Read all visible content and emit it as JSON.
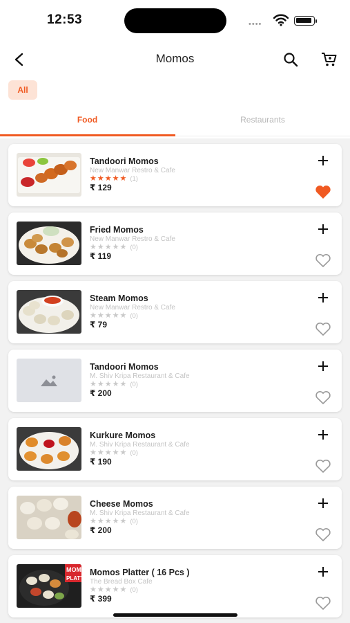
{
  "status_bar": {
    "time": "12:53"
  },
  "header": {
    "title": "Momos"
  },
  "filter": {
    "chip_label": "All"
  },
  "tabs": [
    {
      "label": "Food",
      "active": true
    },
    {
      "label": "Restaurants",
      "active": false
    }
  ],
  "colors": {
    "accent": "#f05a22",
    "chip_bg": "#fde3d6",
    "placeholder_bg": "#dfe1e6"
  },
  "items": [
    {
      "name": "Tandoori Momos",
      "restaurant": "New Manwar Restro & Cafe",
      "stars": "★★★★★",
      "rating_count": "(1)",
      "rating": 5,
      "price": "₹ 129",
      "favorite": true,
      "image": "tandoori-momos-photo"
    },
    {
      "name": "Fried Momos",
      "restaurant": "New Manwar Restro & Cafe",
      "stars": "★★★★★",
      "rating_count": "(0)",
      "rating": 0,
      "price": "₹ 119",
      "favorite": false,
      "image": "fried-momos-photo"
    },
    {
      "name": "Steam Momos",
      "restaurant": "New Manwar Restro & Cafe",
      "stars": "★★★★★",
      "rating_count": "(0)",
      "rating": 0,
      "price": "₹ 79",
      "favorite": false,
      "image": "steam-momos-photo"
    },
    {
      "name": "Tandoori Momos",
      "restaurant": "M. Shiv Kripa Restaurant & Cafe",
      "stars": "★★★★★",
      "rating_count": "(0)",
      "rating": 0,
      "price": "₹ 200",
      "favorite": false,
      "image": "placeholder-image-icon"
    },
    {
      "name": "Kurkure Momos",
      "restaurant": "M. Shiv Kripa Restaurant & Cafe",
      "stars": "★★★★★",
      "rating_count": "(0)",
      "rating": 0,
      "price": "₹ 190",
      "favorite": false,
      "image": "kurkure-momos-photo"
    },
    {
      "name": "Cheese Momos",
      "restaurant": "M. Shiv Kripa Restaurant & Cafe",
      "stars": "★★★★★",
      "rating_count": "(0)",
      "rating": 0,
      "price": "₹ 200",
      "favorite": false,
      "image": "cheese-momos-photo"
    },
    {
      "name": "Momos Platter ( 16 Pcs )",
      "restaurant": "The Bread Box Cafe",
      "stars": "★★★★★",
      "rating_count": "(0)",
      "rating": 0,
      "price": "₹ 399",
      "favorite": false,
      "image": "momos-platter-photo",
      "image_text": "MOM PLATT"
    }
  ]
}
